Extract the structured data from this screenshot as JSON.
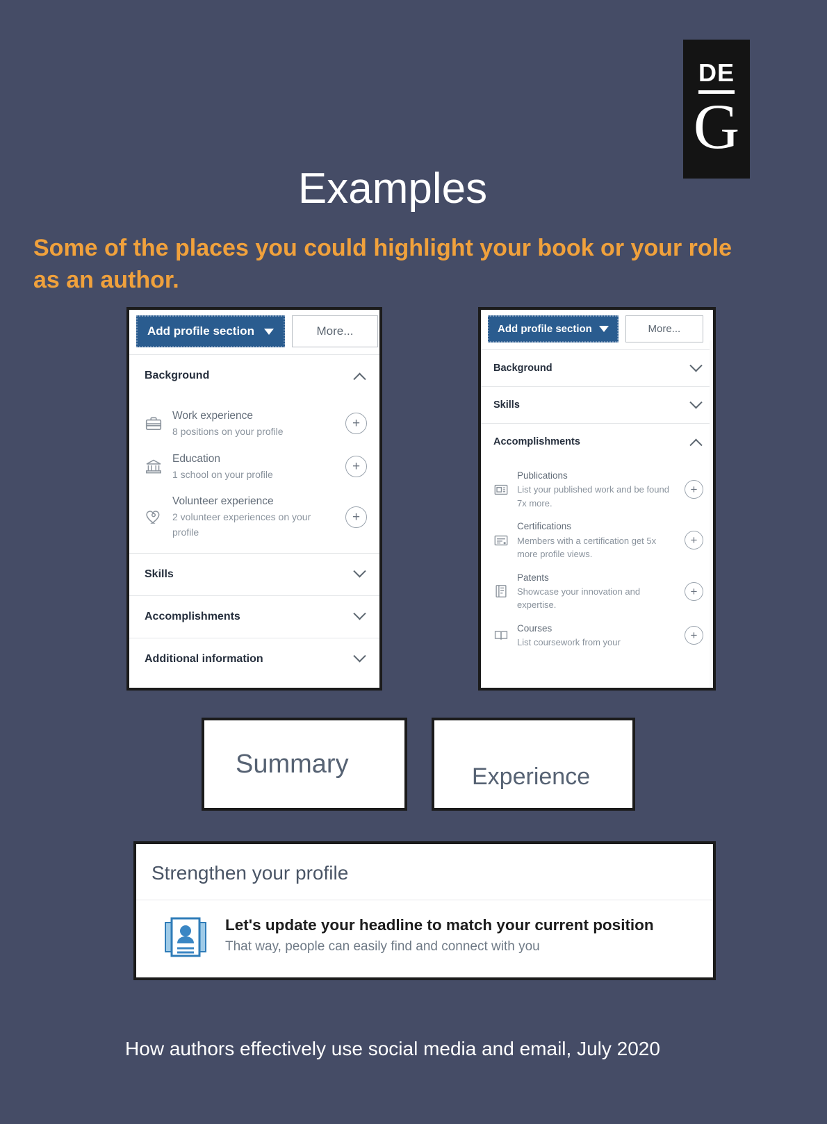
{
  "logo": {
    "top_text": "DE",
    "bottom_text": "G"
  },
  "header": {
    "title": "Examples",
    "subtitle": "Some of the places you could highlight your book or your role as an author."
  },
  "colors": {
    "background": "#454c66",
    "accent_orange": "#f0a13c",
    "linkedin_blue": "#2a5c8f",
    "panel_border": "#1b1b1b"
  },
  "left_panel": {
    "add_button_label": "Add profile section",
    "more_button_label": "More...",
    "sections": [
      {
        "label": "Background",
        "state": "expanded"
      },
      {
        "label": "Skills",
        "state": "collapsed"
      },
      {
        "label": "Accomplishments",
        "state": "collapsed"
      },
      {
        "label": "Additional information",
        "state": "collapsed"
      }
    ],
    "background_items": [
      {
        "icon": "briefcase-icon",
        "title": "Work experience",
        "subtitle": "8 positions on your profile",
        "add_label": "+"
      },
      {
        "icon": "school-icon",
        "title": "Education",
        "subtitle": "1 school on your profile",
        "add_label": "+"
      },
      {
        "icon": "heart-icon",
        "title": "Volunteer experience",
        "subtitle": "2 volunteer experiences on your profile",
        "add_label": "+"
      }
    ]
  },
  "right_panel": {
    "add_button_label": "Add profile section",
    "more_button_label": "More...",
    "sections": [
      {
        "label": "Background",
        "state": "collapsed"
      },
      {
        "label": "Skills",
        "state": "collapsed"
      },
      {
        "label": "Accomplishments",
        "state": "expanded"
      }
    ],
    "accomplishment_items": [
      {
        "icon": "publication-icon",
        "title": "Publications",
        "subtitle": "List your published work and be found 7x more.",
        "add_label": "+"
      },
      {
        "icon": "certificate-icon",
        "title": "Certifications",
        "subtitle": "Members with a certification get 5x more profile views.",
        "add_label": "+"
      },
      {
        "icon": "patent-icon",
        "title": "Patents",
        "subtitle": "Showcase your innovation and expertise.",
        "add_label": "+"
      },
      {
        "icon": "course-icon",
        "title": "Courses",
        "subtitle": "List coursework from your",
        "add_label": "+"
      }
    ]
  },
  "cards": {
    "summary": "Summary",
    "experience": "Experience"
  },
  "strengthen": {
    "title": "Strengthen your profile",
    "icon": "profile-card-icon",
    "headline": "Let's update your headline to match your current position",
    "subtext": "That way, people can easily find and connect with you"
  },
  "footer": {
    "text": "How authors effectively use social media and email, July 2020"
  }
}
